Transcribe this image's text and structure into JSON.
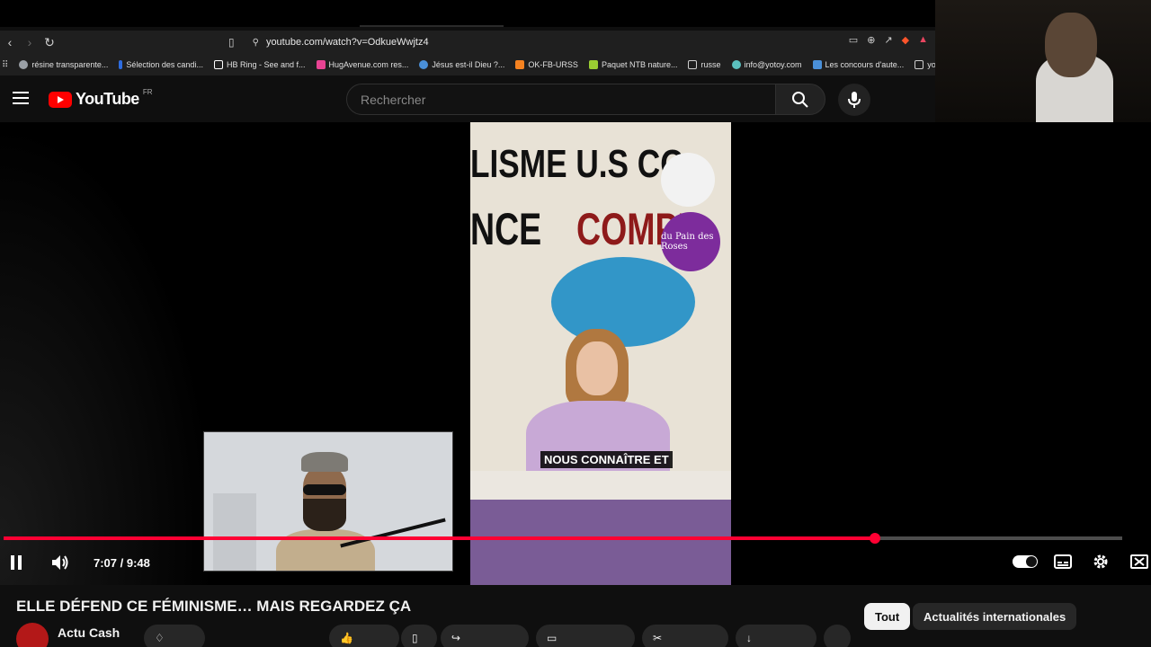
{
  "browser": {
    "url": "youtube.com/watch?v=OdkueWwjtz4",
    "bookmarks": [
      {
        "label": "résine transparente...",
        "color": "#9aa0a6"
      },
      {
        "label": "Sélection des candi...",
        "color": "#2d6cdf"
      },
      {
        "label": "HB Ring - See and f...",
        "color": "#ffffff"
      },
      {
        "label": "HugAvenue.com res...",
        "color": "#e84393"
      },
      {
        "label": "Jésus est-il Dieu ?...",
        "color": "#4a90d9"
      },
      {
        "label": "OK-FB-URSS",
        "color": "#f58220"
      },
      {
        "label": "Paquet NTB nature...",
        "color": "#9acd32"
      },
      {
        "label": "russe",
        "color": "#cfcfcf"
      },
      {
        "label": "info@yotoy.com",
        "color": "#5bc0be"
      },
      {
        "label": "Les concours d'aute...",
        "color": "#4a90d9"
      },
      {
        "label": "yo",
        "color": "#cfcfcf"
      }
    ]
  },
  "youtube": {
    "logo_text": "YouTube",
    "country": "FR",
    "search_placeholder": "Rechercher"
  },
  "video": {
    "subtitle": "NOUS CONNAÎTRE ET",
    "current_time": "7:07",
    "duration": "9:48",
    "time_display": "7:07 / 9:48",
    "progress_fraction": 0.7793,
    "banner_line1": "LISME U.S CO",
    "banner_line2": "NCE",
    "banner_line3": "COMPL",
    "badge_text": "du Pain des Roses"
  },
  "below": {
    "title": "ELLE DÉFEND CE FÉMINISME… MAIS REGARDEZ ÇA",
    "channel": "Actu Cash",
    "chips": [
      "Tout",
      "Actualités internationales"
    ]
  },
  "colors": {
    "accent": "#ff0033",
    "brand": "#ff0000"
  }
}
